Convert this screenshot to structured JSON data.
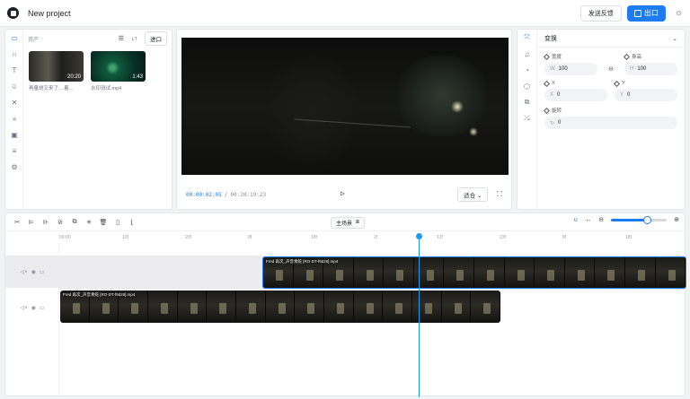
{
  "header": {
    "project_title": "New project",
    "feedback_label": "发送反馈",
    "export_label": "出口"
  },
  "assets": {
    "section_label": "资产",
    "import_label": "进口",
    "items": [
      {
        "name": "再量烧又来了:...着...",
        "duration": "20:20"
      },
      {
        "name": "水印测试.mp4",
        "duration": "1:43"
      }
    ]
  },
  "preview": {
    "current_time": "00:00:02:05",
    "separator": "/",
    "total_time": "00:20:19:23",
    "fit_label": "适合"
  },
  "properties": {
    "title": "变换",
    "width_label": "宽度",
    "height_label": "身高",
    "width_prefix": "W",
    "width_value": "100",
    "height_prefix": "H",
    "height_value": "100",
    "x_label": "X",
    "y_label": "Y",
    "x_prefix": "X",
    "x_value": "0",
    "y_prefix": "Y",
    "y_value": "0",
    "rotation_label": "旋转",
    "rotation_value": "0"
  },
  "timeline": {
    "main_track_label": "主场景",
    "ruler_ticks": [
      "00:00",
      "10f",
      "20f",
      "8f",
      "18f",
      "2f",
      "12f",
      "23f",
      "8f",
      "18f"
    ],
    "clips": [
      {
        "name": "Fred 再次_声音青蛇 [RO-DT-f9dz8].mp4"
      },
      {
        "name": "Fred 再次_声音青蛇 [RO-DT-f9dz8].mp4"
      }
    ],
    "zoom_level": 0.65
  },
  "colors": {
    "accent": "#1d7cf2",
    "playhead": "#1d9bf0"
  }
}
